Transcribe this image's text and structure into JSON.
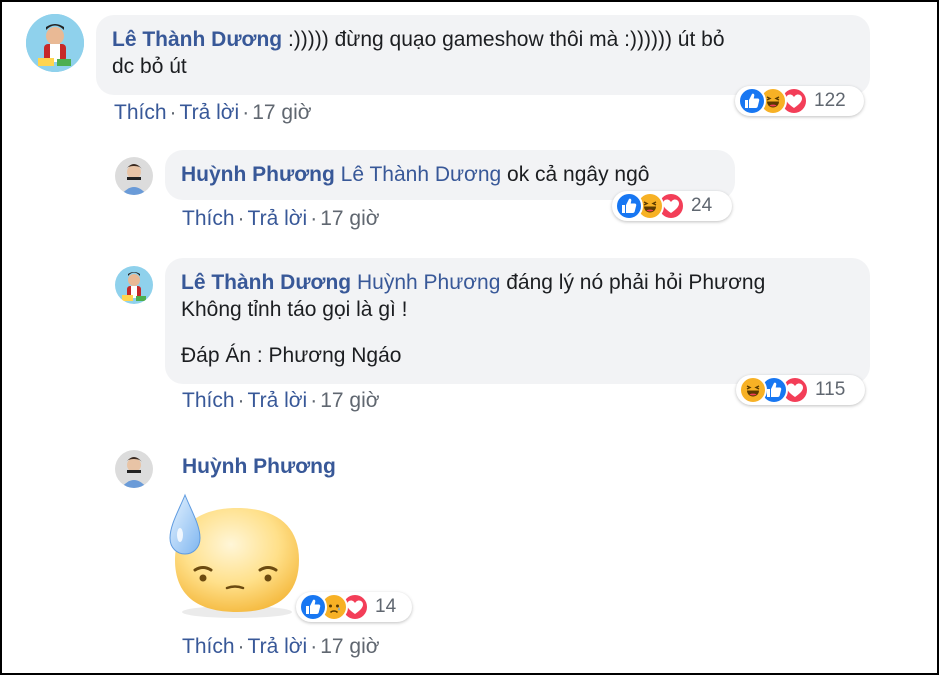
{
  "comments": [
    {
      "author": "Lê Thành Dương",
      "text_lines": [
        ":))))) đừng quạo gameshow thôi mà :)))))) út bỏ",
        "dc bỏ út"
      ],
      "reactions": {
        "icons": [
          "like-icon",
          "haha-icon",
          "love-icon"
        ],
        "count": "122"
      },
      "actions": {
        "like": "Thích",
        "reply": "Trả lời",
        "time": "17 giờ"
      }
    },
    {
      "author": "Huỳnh Phương",
      "mention": "Lê Thành Dương",
      "text": "ok cả ngây ngô",
      "reactions": {
        "icons": [
          "like-icon",
          "haha-icon",
          "love-icon"
        ],
        "count": "24"
      },
      "actions": {
        "like": "Thích",
        "reply": "Trả lời",
        "time": "17 giờ"
      }
    },
    {
      "author": "Lê Thành Dương",
      "mention": "Huỳnh Phương",
      "line1": "đáng lý nó phải hỏi Phương",
      "line2": "Không tỉnh táo gọi là gì !",
      "line3": "Đáp Án : Phương Ngáo",
      "reactions": {
        "icons": [
          "haha-icon",
          "like-icon",
          "love-icon"
        ],
        "count": "115"
      },
      "actions": {
        "like": "Thích",
        "reply": "Trả lời",
        "time": "17 giờ"
      }
    },
    {
      "author": "Huỳnh Phương",
      "sticker": "sweat-face-sticker",
      "reactions": {
        "icons": [
          "like-icon",
          "sad-icon",
          "love-icon"
        ],
        "count": "14"
      },
      "actions": {
        "like": "Thích",
        "reply": "Trả lời",
        "time": "17 giờ"
      }
    }
  ],
  "colors": {
    "author": "#385898",
    "bubble": "#f2f3f5",
    "meta": "#606770",
    "like": "#1877f2",
    "love": "#f33e58",
    "haha": "#f7b125"
  }
}
